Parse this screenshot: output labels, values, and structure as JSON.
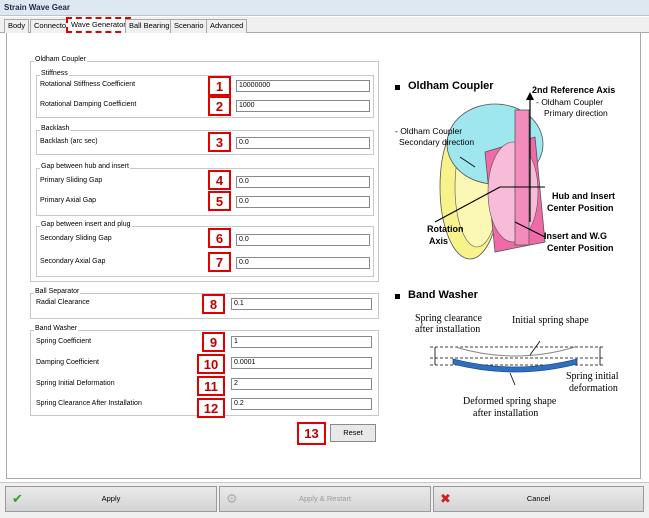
{
  "window": {
    "title": "Strain Wave Gear"
  },
  "tabs": [
    {
      "label": "Body"
    },
    {
      "label": "Connector"
    },
    {
      "label": "Wave Generator"
    },
    {
      "label": "Ball Bearing"
    },
    {
      "label": "Scenario"
    },
    {
      "label": "Advanced"
    }
  ],
  "groups": {
    "oldham": "Oldham Coupler",
    "stiffness": "Stiffness",
    "backlash": "Backlash",
    "gap_hub": "Gap between hub and insert",
    "gap_plug": "Gap between insert and plug",
    "ball_sep": "Ball Separator",
    "band": "Band Washer"
  },
  "fields": [
    {
      "label": "Rotational Stiffness Coefficient",
      "value": "10000000",
      "num": "1"
    },
    {
      "label": "Rotational Damping Coefficient",
      "value": "1000",
      "num": "2"
    },
    {
      "label": "Backlash (arc sec)",
      "value": "0.0",
      "num": "3"
    },
    {
      "label": "Primary Sliding Gap",
      "value": "0.0",
      "num": "4"
    },
    {
      "label": "Primary Axial Gap",
      "value": "0.0",
      "num": "5"
    },
    {
      "label": "Secondary Sliding Gap",
      "value": "0.0",
      "num": "6"
    },
    {
      "label": "Secondary Axial Gap",
      "value": "0.0",
      "num": "7"
    },
    {
      "label": "Radial Clearance",
      "value": "0.1",
      "num": "8"
    },
    {
      "label": "Spring Coefficient",
      "value": "1",
      "num": "9"
    },
    {
      "label": "Damping Coefficient",
      "value": "0.0001",
      "num": "10"
    },
    {
      "label": "Spring Initial Deformation",
      "value": "2",
      "num": "11"
    },
    {
      "label": "Spring Clearance After Installation",
      "value": "0.2",
      "num": "12"
    }
  ],
  "reset": {
    "label": "Reset",
    "num": "13"
  },
  "diagram_oldham": {
    "heading": "Oldham Coupler",
    "ref_axis": "2nd Reference Axis",
    "primary_1": "- Oldham Coupler",
    "primary_2": "Primary direction",
    "secondary_1": "- Oldham Coupler",
    "secondary_2": "Secondary direction",
    "hub_1": "Hub and Insert",
    "hub_2": "Center Position",
    "rot_1": "Rotation",
    "rot_2": "Axis",
    "wg_1": "Insert and W.G",
    "wg_2": "Center Position"
  },
  "diagram_band": {
    "heading": "Band Washer",
    "clear_1": "Spring clearance",
    "clear_2": "after installation",
    "initial": "Initial spring shape",
    "def_1": "Spring initial",
    "def_2": "deformation",
    "deformed_1": "Deformed spring shape",
    "deformed_2": "after installation"
  },
  "bottom": {
    "apply": "Apply",
    "apply_restart": "Apply & Restart",
    "cancel": "Cancel"
  },
  "colors": {
    "highlight": "#e00000",
    "pink": "#f06aa8",
    "yellow": "#f7f28a",
    "cyan": "#9fe7ef",
    "washer": "#2f6fc0"
  }
}
